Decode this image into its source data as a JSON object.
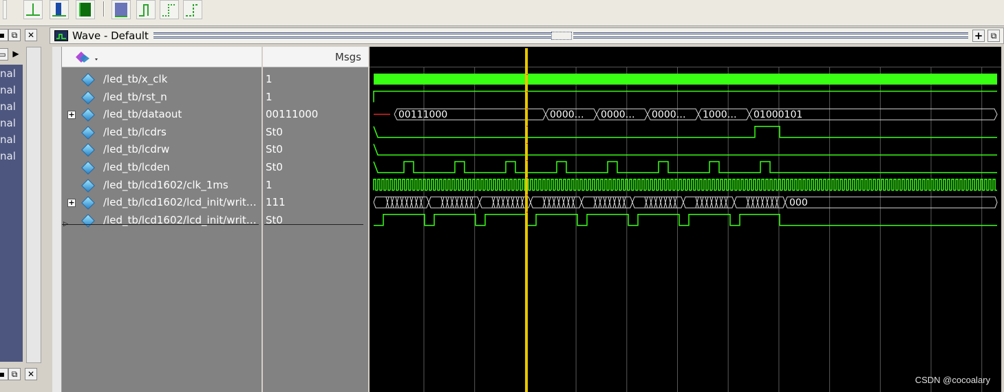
{
  "window": {
    "title": "Wave - Default"
  },
  "left_panel": {
    "items": [
      "nal",
      "nal",
      "nal",
      "nal",
      "nal",
      "nal"
    ]
  },
  "columns": {
    "msgs_label": "Msgs"
  },
  "signals": [
    {
      "name": "/led_tb/x_clk",
      "value": "1",
      "expandable": false
    },
    {
      "name": "/led_tb/rst_n",
      "value": "1",
      "expandable": false
    },
    {
      "name": "/led_tb/dataout",
      "value": "00111000",
      "expandable": true
    },
    {
      "name": "/led_tb/lcdrs",
      "value": "St0",
      "expandable": false
    },
    {
      "name": "/led_tb/lcdrw",
      "value": "St0",
      "expandable": false
    },
    {
      "name": "/led_tb/lcden",
      "value": "St0",
      "expandable": false
    },
    {
      "name": "/led_tb/lcd1602/clk_1ms",
      "value": "1",
      "expandable": false
    },
    {
      "name": "/led_tb/lcd1602/lcd_init/writ…",
      "value": "111",
      "expandable": true
    },
    {
      "name": "/led_tb/lcd1602/lcd_init/writ…",
      "value": "St0",
      "expandable": false
    }
  ],
  "bus_labels": {
    "dataout": [
      "00111000",
      "0000…",
      "0000…",
      "0000…",
      "1000…",
      "01000101"
    ],
    "writ_bus_end": "000"
  },
  "colors": {
    "wave": "#39ff14",
    "cursor": "#e8c600",
    "background": "#000000"
  },
  "credit": "CSDN @cocoalary"
}
